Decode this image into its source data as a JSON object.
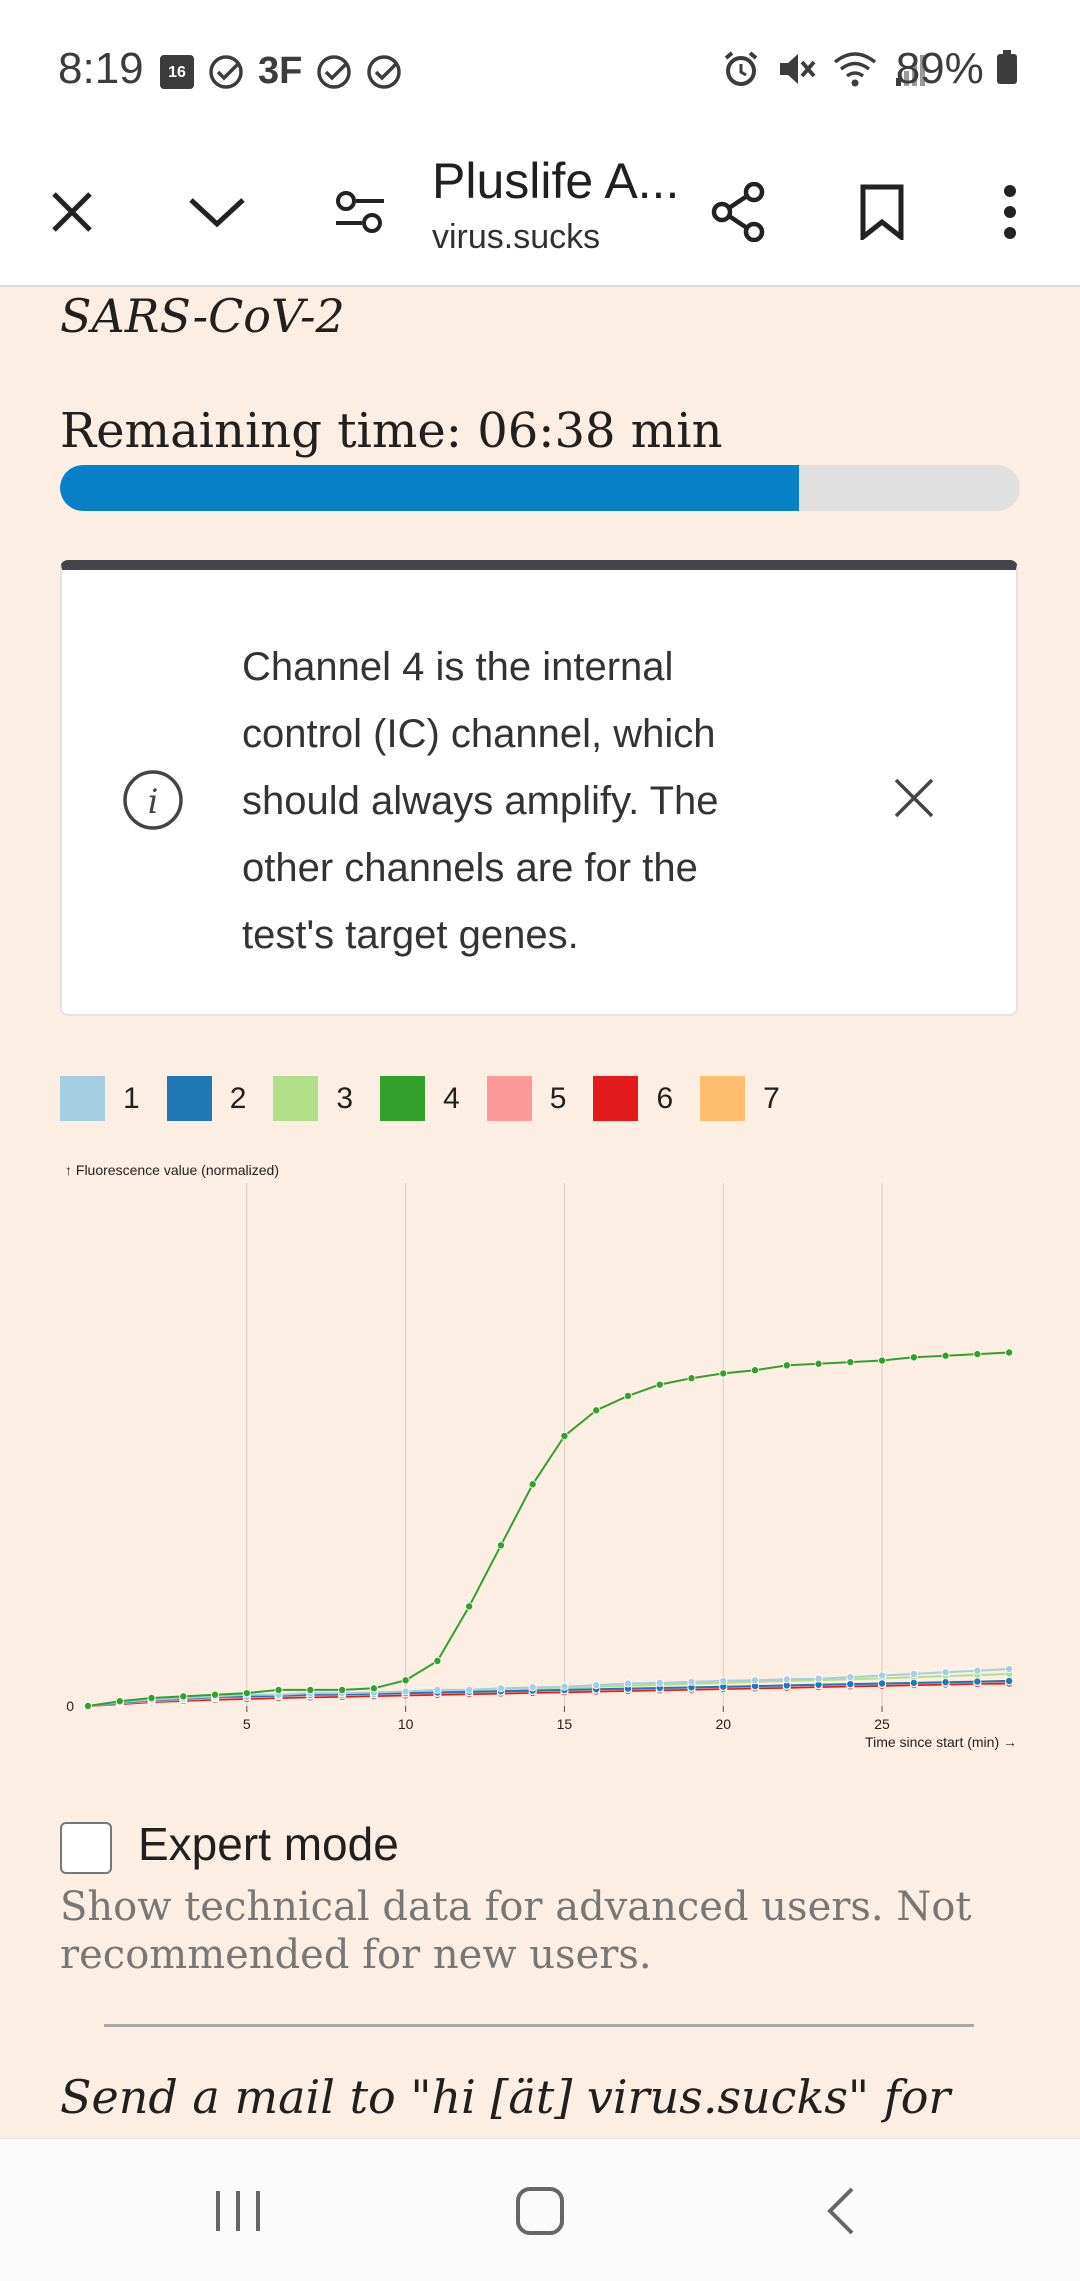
{
  "status_bar": {
    "time": "8:19",
    "calendar_day": "16",
    "badge_3f": "3F",
    "battery": "89%"
  },
  "toolbar": {
    "title": "Pluslife A...",
    "url": "virus.sucks"
  },
  "test": {
    "name": "SARS-CoV-2",
    "remaining_label": "Remaining time: 06:38 min",
    "progress": 0.77,
    "progress_color": "#0780c8"
  },
  "info_card": {
    "text": "Channel 4 is the internal control (IC) channel, which should always amplify. The other channels are for the test's target genes."
  },
  "legend": [
    {
      "label": "1",
      "color": "#a6cee3"
    },
    {
      "label": "2",
      "color": "#1f78b4"
    },
    {
      "label": "3",
      "color": "#b2df8a"
    },
    {
      "label": "4",
      "color": "#33a02c"
    },
    {
      "label": "5",
      "color": "#fb9a99"
    },
    {
      "label": "6",
      "color": "#e31a1c"
    },
    {
      "label": "7",
      "color": "#fdbf6f"
    }
  ],
  "chart_data": {
    "type": "line",
    "ylabel": "↑ Fluorescence value (normalized)",
    "xlabel": "Time since start (min) →",
    "x_ticks": [
      5,
      10,
      15,
      20,
      25
    ],
    "y_ticks": [
      0
    ],
    "xlim": [
      0,
      29.5
    ],
    "ylim": [
      0,
      1.03
    ],
    "grid": "vertical",
    "series": [
      {
        "name": "4",
        "color": "#33a02c",
        "x": [
          0,
          1,
          2,
          3,
          4,
          5,
          6,
          7,
          8,
          9,
          10,
          11,
          12,
          13,
          14,
          15,
          16,
          17,
          18,
          19,
          20,
          21,
          22,
          23,
          24,
          25,
          26,
          27,
          28,
          29
        ],
        "y": [
          0.0,
          0.015,
          0.025,
          0.03,
          0.035,
          0.04,
          0.05,
          0.05,
          0.05,
          0.055,
          0.08,
          0.14,
          0.31,
          0.5,
          0.69,
          0.84,
          0.92,
          0.965,
          1.0,
          1.02,
          1.035,
          1.045,
          1.06,
          1.065,
          1.07,
          1.075,
          1.085,
          1.09,
          1.095,
          1.1
        ]
      },
      {
        "name": "1",
        "color": "#a6cee3",
        "x": [
          0,
          1,
          2,
          3,
          4,
          5,
          6,
          7,
          8,
          9,
          10,
          11,
          12,
          13,
          14,
          15,
          16,
          17,
          18,
          19,
          20,
          21,
          22,
          23,
          24,
          25,
          26,
          27,
          28,
          29
        ],
        "y": [
          0.0,
          0.012,
          0.02,
          0.025,
          0.03,
          0.035,
          0.035,
          0.04,
          0.04,
          0.042,
          0.045,
          0.05,
          0.05,
          0.055,
          0.058,
          0.06,
          0.065,
          0.07,
          0.072,
          0.075,
          0.078,
          0.08,
          0.083,
          0.085,
          0.09,
          0.095,
          0.1,
          0.105,
          0.11,
          0.115
        ]
      },
      {
        "name": "2",
        "color": "#1f78b4",
        "x": [
          0,
          1,
          2,
          3,
          4,
          5,
          6,
          7,
          8,
          9,
          10,
          11,
          12,
          13,
          14,
          15,
          16,
          17,
          18,
          19,
          20,
          21,
          22,
          23,
          24,
          25,
          26,
          27,
          28,
          29
        ],
        "y": [
          0.0,
          0.01,
          0.018,
          0.022,
          0.028,
          0.03,
          0.032,
          0.035,
          0.036,
          0.038,
          0.04,
          0.042,
          0.044,
          0.046,
          0.048,
          0.05,
          0.052,
          0.054,
          0.056,
          0.058,
          0.06,
          0.062,
          0.064,
          0.066,
          0.068,
          0.07,
          0.072,
          0.074,
          0.076,
          0.078
        ]
      },
      {
        "name": "3",
        "color": "#b2df8a",
        "x": [
          0,
          1,
          2,
          3,
          4,
          5,
          6,
          7,
          8,
          9,
          10,
          11,
          12,
          13,
          14,
          15,
          16,
          17,
          18,
          19,
          20,
          21,
          22,
          23,
          24,
          25,
          26,
          27,
          28,
          29
        ],
        "y": [
          0.0,
          0.01,
          0.018,
          0.022,
          0.026,
          0.03,
          0.032,
          0.034,
          0.036,
          0.038,
          0.04,
          0.043,
          0.046,
          0.05,
          0.053,
          0.056,
          0.06,
          0.063,
          0.066,
          0.069,
          0.072,
          0.075,
          0.078,
          0.08,
          0.083,
          0.086,
          0.09,
          0.093,
          0.096,
          0.1
        ]
      },
      {
        "name": "5",
        "color": "#fb9a99",
        "x": [
          0,
          1,
          2,
          3,
          4,
          5,
          6,
          7,
          8,
          9,
          10,
          11,
          12,
          13,
          14,
          15,
          16,
          17,
          18,
          19,
          20,
          21,
          22,
          23,
          24,
          25,
          26,
          27,
          28,
          29
        ],
        "y": [
          0.0,
          0.008,
          0.015,
          0.02,
          0.024,
          0.027,
          0.03,
          0.032,
          0.034,
          0.036,
          0.038,
          0.04,
          0.042,
          0.044,
          0.046,
          0.048,
          0.05,
          0.052,
          0.054,
          0.056,
          0.058,
          0.06,
          0.062,
          0.064,
          0.066,
          0.068,
          0.07,
          0.072,
          0.074,
          0.076
        ]
      },
      {
        "name": "6",
        "color": "#e31a1c",
        "x": [
          0,
          1,
          2,
          3,
          4,
          5,
          6,
          7,
          8,
          9,
          10,
          11,
          12,
          13,
          14,
          15,
          16,
          17,
          18,
          19,
          20,
          21,
          22,
          23,
          24,
          25,
          26,
          27,
          28,
          29
        ],
        "y": [
          0.0,
          0.006,
          0.012,
          0.016,
          0.02,
          0.022,
          0.025,
          0.027,
          0.029,
          0.031,
          0.033,
          0.035,
          0.037,
          0.039,
          0.041,
          0.043,
          0.045,
          0.047,
          0.049,
          0.051,
          0.053,
          0.055,
          0.057,
          0.059,
          0.061,
          0.063,
          0.065,
          0.067,
          0.069,
          0.07
        ]
      },
      {
        "name": "7",
        "color": "#fdbf6f",
        "x": [
          0,
          1,
          2,
          3,
          4,
          5,
          6,
          7,
          8,
          9,
          10,
          11,
          12,
          13,
          14,
          15,
          16,
          17,
          18,
          19,
          20,
          21,
          22,
          23,
          24,
          25,
          26,
          27,
          28,
          29
        ],
        "y": [
          0.0,
          0.007,
          0.013,
          0.018,
          0.022,
          0.025,
          0.028,
          0.03,
          0.032,
          0.034,
          0.036,
          0.038,
          0.04,
          0.042,
          0.044,
          0.046,
          0.048,
          0.05,
          0.052,
          0.054,
          0.056,
          0.058,
          0.06,
          0.062,
          0.064,
          0.066,
          0.068,
          0.07,
          0.072,
          0.074
        ]
      }
    ]
  },
  "expert_mode": {
    "label": "Expert mode",
    "checked": false,
    "description": "Show technical data for advanced users. Not recommended for new users."
  },
  "footer": {
    "mail_text": "Send a mail to \"hi [ät] virus.sucks\" for"
  }
}
